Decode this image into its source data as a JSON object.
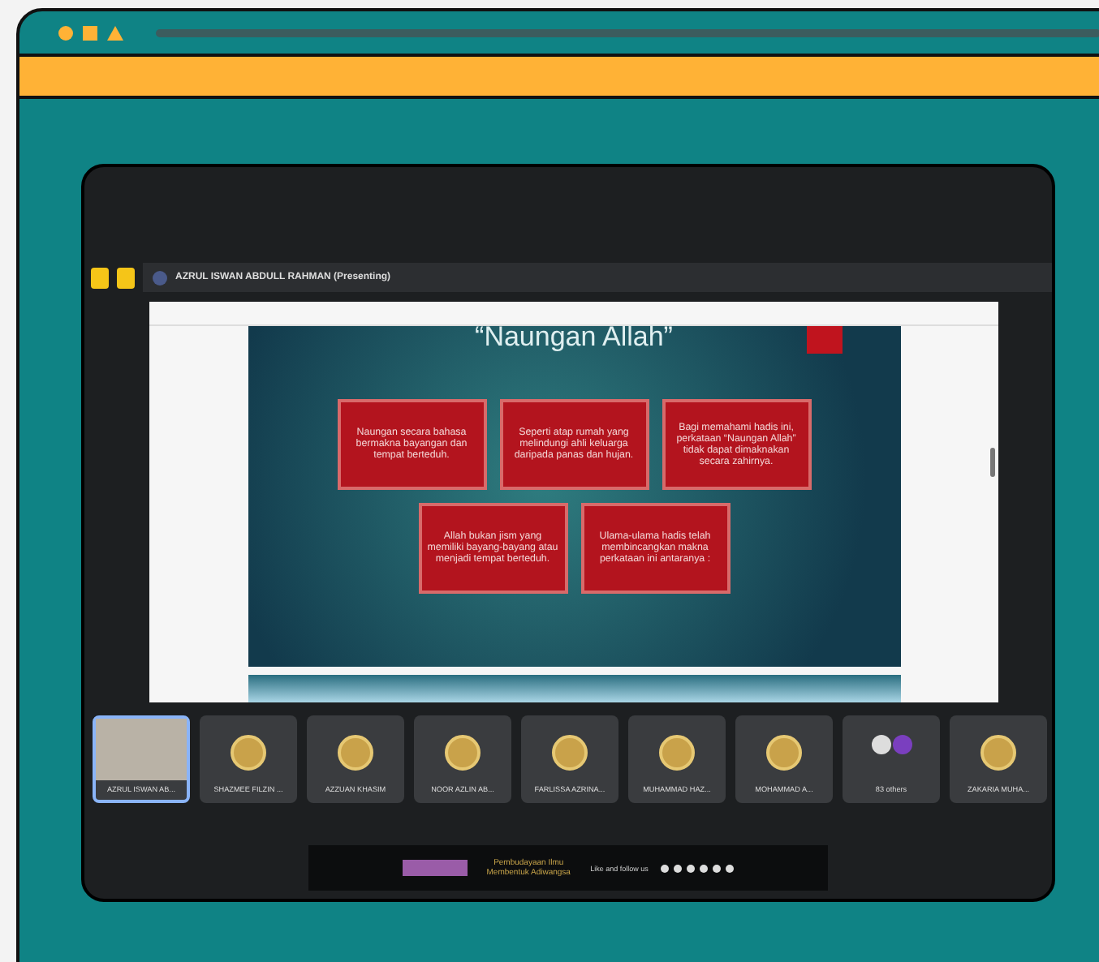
{
  "meeting": {
    "presenter": "AZRUL ISWAN ABDULL RAHMAN (Presenting)"
  },
  "slide": {
    "title": "“Naungan Allah”",
    "boxes": [
      {
        "text": "Naungan secara bahasa bermakna bayangan dan tempat berteduh."
      },
      {
        "text": "Seperti atap rumah yang melindungi ahli keluarga daripada panas dan hujan."
      },
      {
        "text": "Bagi memahami hadis ini, perkataan “Naungan Allah” tidak dapat dimaknakan secara zahirnya."
      },
      {
        "text": "Allah bukan jism yang memiliki bayang-bayang atau menjadi tempat berteduh."
      },
      {
        "text": "Ulama-ulama hadis telah membincangkan makna perkataan ini antaranya :"
      }
    ]
  },
  "participants": [
    {
      "name": "AZRUL ISWAN AB...",
      "kind": "video",
      "selected": true
    },
    {
      "name": "SHAZMEE FILZIN ...",
      "kind": "avatar",
      "selected": false
    },
    {
      "name": "AZZUAN KHASIM",
      "kind": "avatar",
      "selected": false
    },
    {
      "name": "NOOR AZLIN AB...",
      "kind": "avatar",
      "selected": false
    },
    {
      "name": "FARLISSA AZRINA...",
      "kind": "avatar",
      "selected": false
    },
    {
      "name": "MUHAMMAD HAZ...",
      "kind": "avatar",
      "selected": false
    },
    {
      "name": "MOHAMMAD A...",
      "kind": "avatar",
      "selected": false
    },
    {
      "name": "83 others",
      "kind": "others",
      "selected": false
    },
    {
      "name": "ZAKARIA MUHA...",
      "kind": "avatar",
      "selected": false
    }
  ],
  "footer": {
    "tagline": "Pembudayaan Ilmu Membentuk Adiwangsa",
    "follow": "Like and follow us"
  }
}
